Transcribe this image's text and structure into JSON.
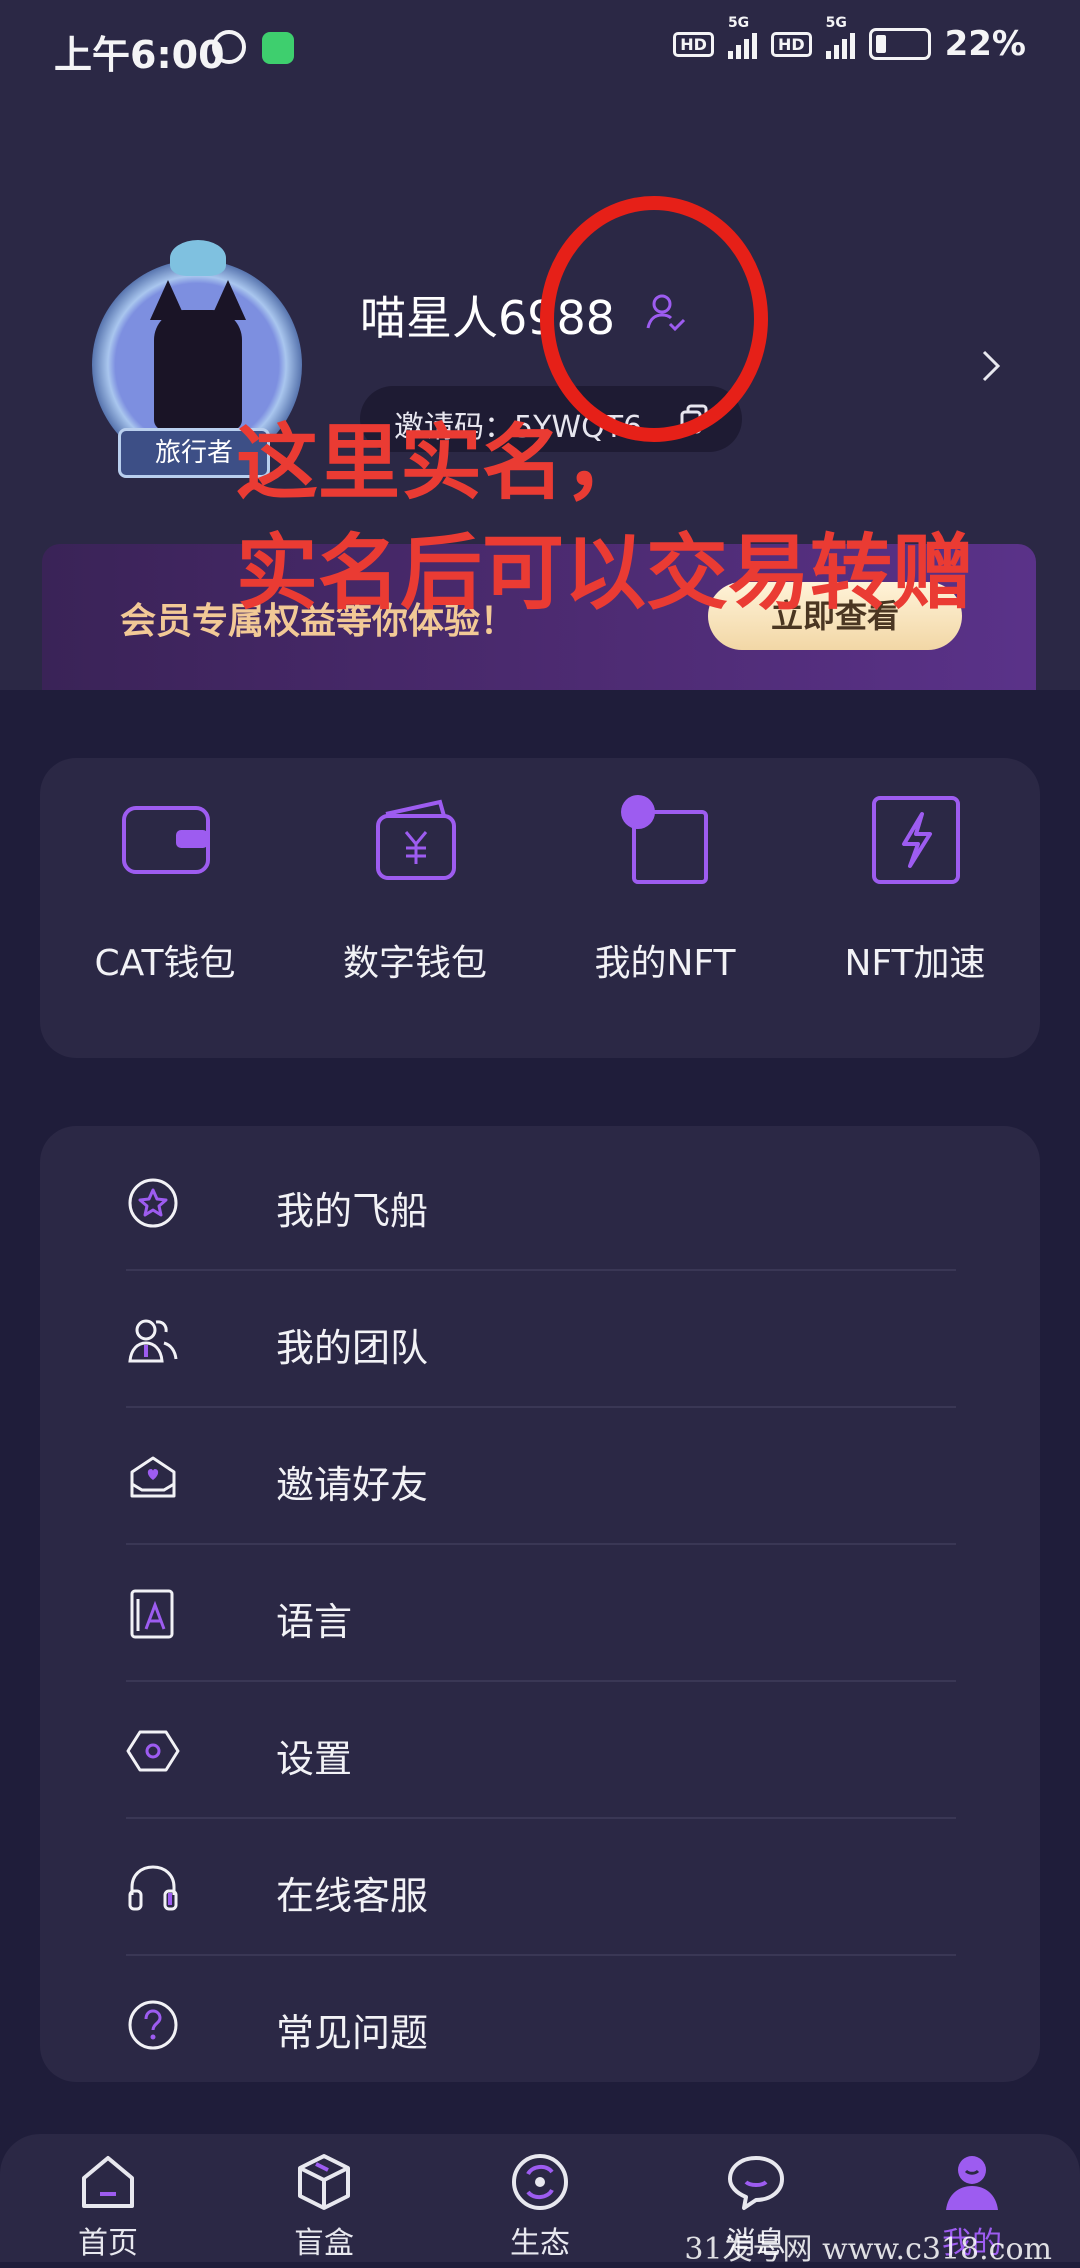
{
  "status_bar": {
    "time": "上午6:00",
    "hd_1": "HD",
    "hd_2": "HD",
    "net_1": "5G",
    "net_2": "5G",
    "battery": "22%",
    "battery_level": 0.22
  },
  "profile": {
    "username": "喵星人6988",
    "badge": "旅行者",
    "invite_code": "邀请码：5YWQT6"
  },
  "annotation": {
    "line_1": "这里实名，",
    "line_2": "实名后可以交易转赠",
    "color": "#e62018"
  },
  "member_banner": {
    "text": "会员专属权益等你体验！",
    "button": "立即查看"
  },
  "quick_actions": [
    {
      "label": "CAT钱包",
      "icon": "wallet-icon"
    },
    {
      "label": "数字钱包",
      "icon": "yuan-wallet-icon"
    },
    {
      "label": "我的NFT",
      "icon": "nft-icon"
    },
    {
      "label": "NFT加速",
      "icon": "lightning-icon"
    }
  ],
  "menu": [
    {
      "label": "我的飞船",
      "icon": "star-circle-icon"
    },
    {
      "label": "我的团队",
      "icon": "team-icon"
    },
    {
      "label": "邀请好友",
      "icon": "envelope-heart-icon"
    },
    {
      "label": "语言",
      "icon": "language-icon"
    },
    {
      "label": "设置",
      "icon": "hexagon-settings-icon"
    },
    {
      "label": "在线客服",
      "icon": "headset-icon"
    },
    {
      "label": "常见问题",
      "icon": "question-circle-icon"
    }
  ],
  "bottom_nav": [
    {
      "label": "首页",
      "icon": "home-icon"
    },
    {
      "label": "盲盒",
      "icon": "box-icon"
    },
    {
      "label": "生态",
      "icon": "ecology-icon"
    },
    {
      "label": "消息",
      "icon": "chat-icon"
    },
    {
      "label": "我的",
      "icon": "profile-icon",
      "active": true
    }
  ],
  "watermark": "31发号网 www.c318.com",
  "colors": {
    "background": "#1f1d3a",
    "card": "#2b2845",
    "accent": "#9d5cf0",
    "member_text": "#f2c996"
  }
}
